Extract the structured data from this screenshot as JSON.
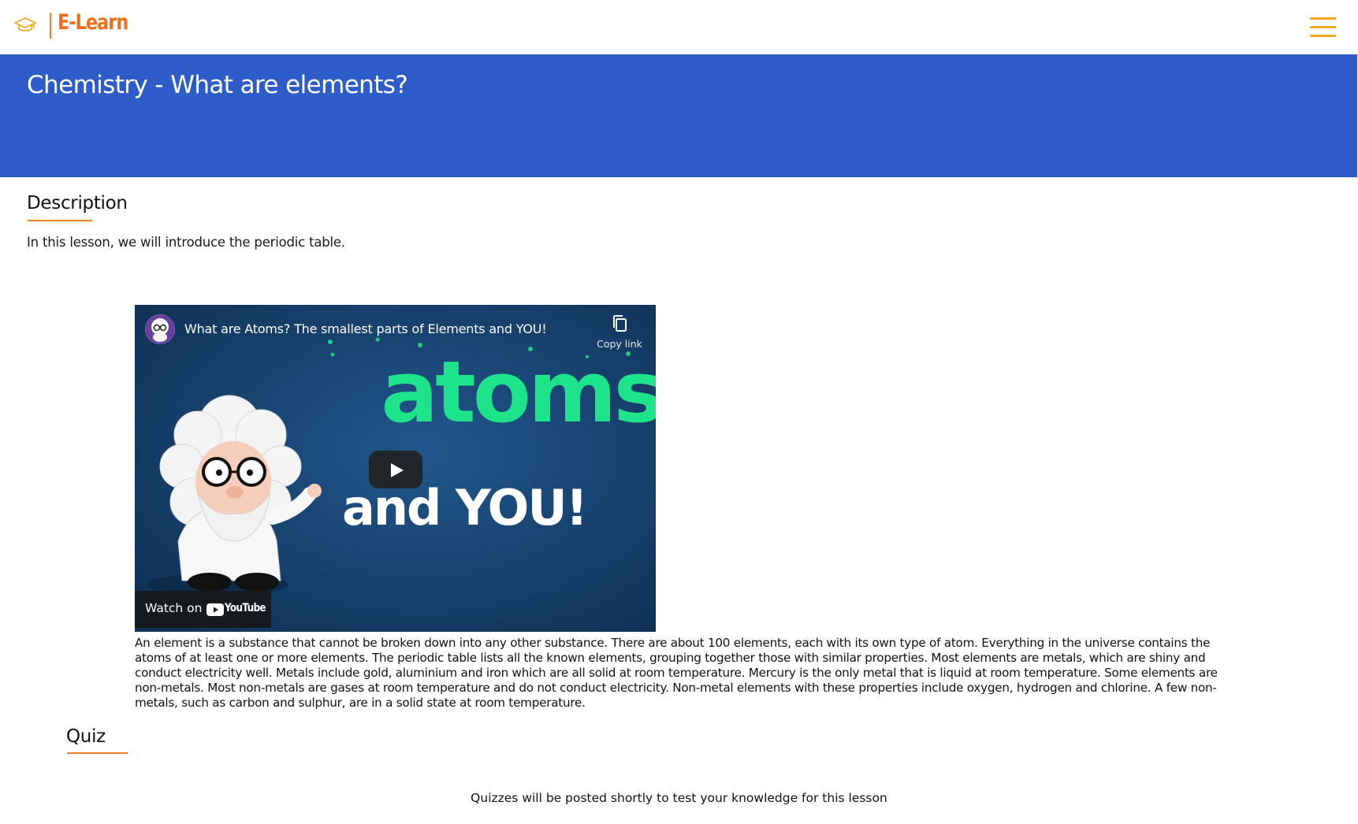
{
  "navbar": {
    "brand_name": "E-Learn",
    "brand_icon": "graduation-cap-icon",
    "menu_icon": "hamburger-menu-icon"
  },
  "hero": {
    "title": "Chemistry - What are elements?"
  },
  "description": {
    "heading": "Description",
    "text": "In this lesson, we will introduce the periodic table."
  },
  "video": {
    "title": "What are Atoms? The smallest parts of Elements and YOU!",
    "copy_link_label": "Copy link",
    "watch_on_label": "Watch on",
    "youtube_label": "YouTube",
    "thumbnail_word_top": "atoms",
    "thumbnail_word_bottom": "and YOU!"
  },
  "lesson_text": "An element is a substance that cannot be broken down into any other substance. There are about 100 elements, each with its own type of atom. Everything in the universe contains the atoms of at least one or more elements. The periodic table lists all the known elements, grouping together those with similar properties. Most elements are metals, which are shiny and conduct electricity well. Metals include gold, aluminium and iron which are all solid at room temperature. Mercury is the only metal that is liquid at room temperature. Some elements are non-metals. Most non-metals are gases at room temperature and do not conduct electricity. Non-metal elements with these properties include oxygen, hydrogen and chlorine. A few non-metals, such as carbon and sulphur, are in a solid state at room temperature.",
  "quiz": {
    "heading": "Quiz",
    "note": "Quizzes will be posted shortly to test your knowledge for this lesson"
  },
  "colors": {
    "accent_orange": "#f57c20",
    "hero_blue": "#2e5cc8",
    "menu_yellow": "#f5a623",
    "thumbnail_green": "#1de38a"
  }
}
